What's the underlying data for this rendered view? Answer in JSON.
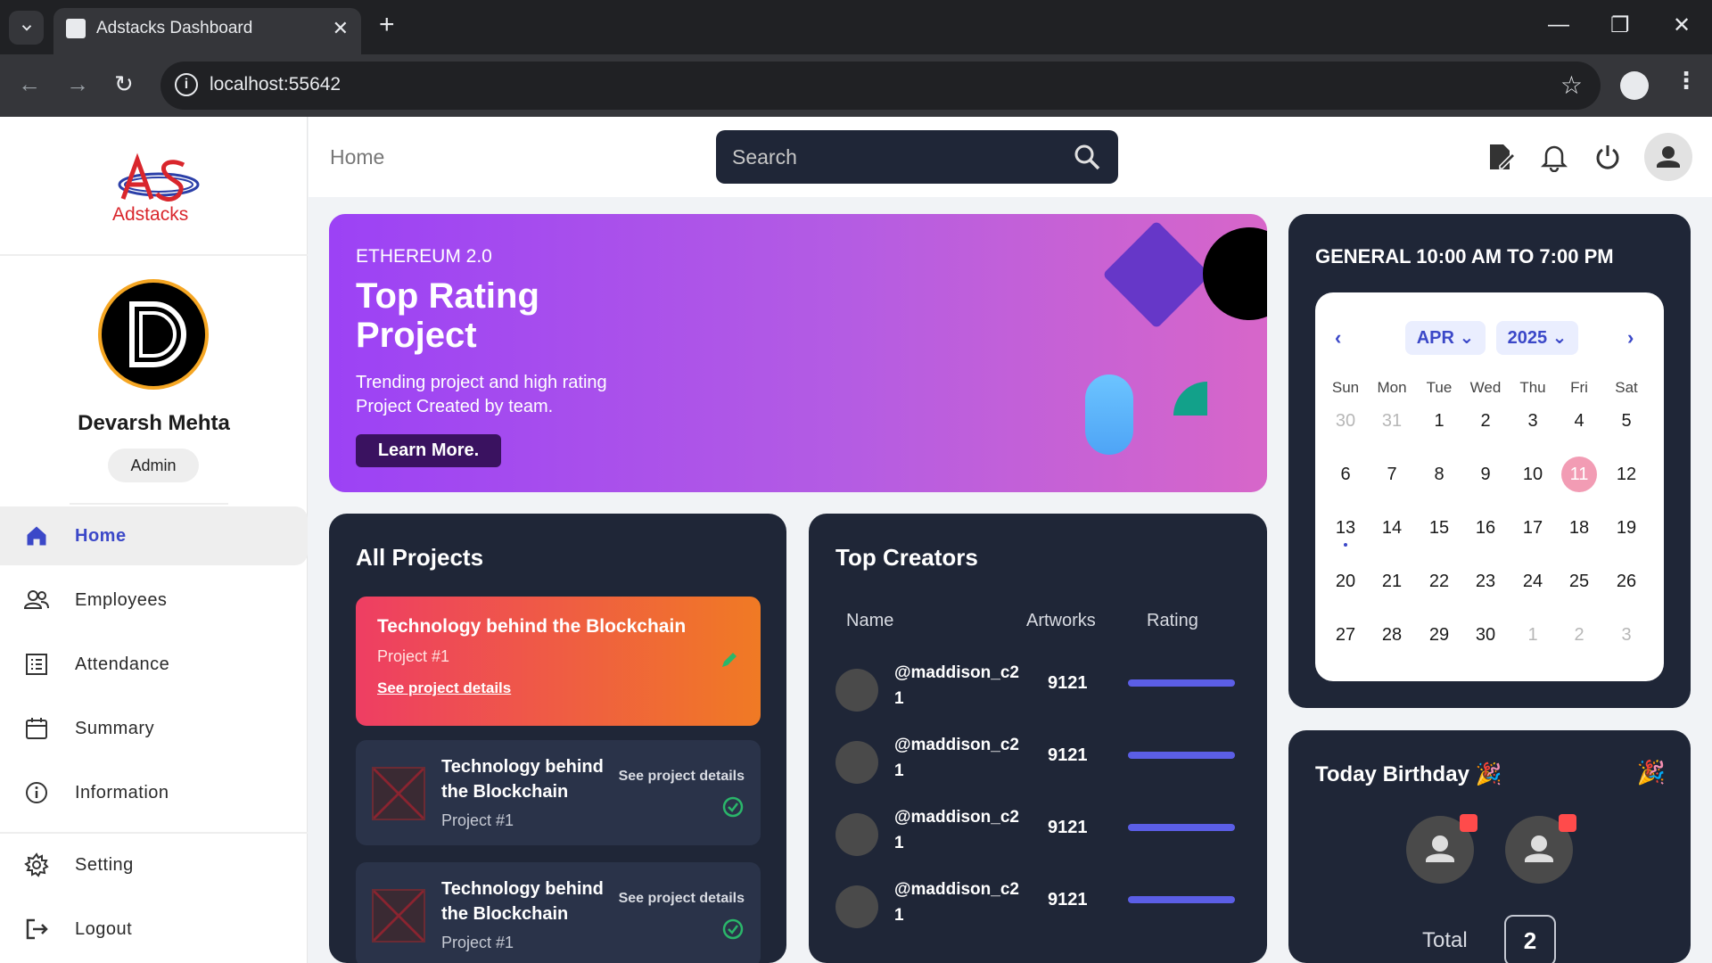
{
  "browser": {
    "tab_title": "Adstacks Dashboard",
    "url": "localhost:55642"
  },
  "sidebar": {
    "logo_text": "Adstacks",
    "user_name": "Devarsh Mehta",
    "role": "Admin",
    "items": [
      {
        "label": "Home",
        "icon": "home-icon",
        "active": true
      },
      {
        "label": "Employees",
        "icon": "people-icon"
      },
      {
        "label": "Attendance",
        "icon": "list-icon"
      },
      {
        "label": "Summary",
        "icon": "calendar-icon"
      },
      {
        "label": "Information",
        "icon": "info-icon"
      },
      {
        "label": "Setting",
        "icon": "gear-icon"
      },
      {
        "label": "Logout",
        "icon": "logout-icon"
      }
    ]
  },
  "topbar": {
    "breadcrumb": "Home",
    "search_placeholder": "Search"
  },
  "banner": {
    "kicker": "ETHEREUM 2.0",
    "title": "Top Rating Project",
    "desc_line1": "Trending project and high rating",
    "desc_line2": "Project Created by team.",
    "button": "Learn More."
  },
  "projects": {
    "title": "All Projects",
    "featured": {
      "title": "Technology behind the Blockchain",
      "sub": "Project #1",
      "link": "See project details"
    },
    "rows": [
      {
        "title": "Technology behind the Blockchain",
        "sub": "Project #1",
        "link": "See project details"
      },
      {
        "title": "Technology behind the Blockchain",
        "sub": "Project #1",
        "link": "See project details"
      }
    ]
  },
  "creators": {
    "title": "Top Creators",
    "headers": {
      "name": "Name",
      "artworks": "Artworks",
      "rating": "Rating"
    },
    "rows": [
      {
        "name": "@maddison_c21",
        "artworks": "9121"
      },
      {
        "name": "@maddison_c21",
        "artworks": "9121"
      },
      {
        "name": "@maddison_c21",
        "artworks": "9121"
      },
      {
        "name": "@maddison_c21",
        "artworks": "9121"
      }
    ]
  },
  "calendar": {
    "title": "GENERAL 10:00 AM TO 7:00 PM",
    "month": "APR",
    "year": "2025",
    "dow": [
      "Sun",
      "Mon",
      "Tue",
      "Wed",
      "Thu",
      "Fri",
      "Sat"
    ],
    "weeks": [
      [
        "30",
        "31",
        "1",
        "2",
        "3",
        "4",
        "5"
      ],
      [
        "6",
        "7",
        "8",
        "9",
        "10",
        "11",
        "12"
      ],
      [
        "13",
        "14",
        "15",
        "16",
        "17",
        "18",
        "19"
      ],
      [
        "20",
        "21",
        "22",
        "23",
        "24",
        "25",
        "26"
      ],
      [
        "27",
        "28",
        "29",
        "30",
        "1",
        "2",
        "3"
      ]
    ],
    "today": "11"
  },
  "birthday": {
    "title": "Today Birthday",
    "total_label": "Total",
    "total": "2"
  },
  "colors": {
    "accent": "#3b48c8",
    "card": "#1f2637",
    "today": "#f29cb4"
  }
}
